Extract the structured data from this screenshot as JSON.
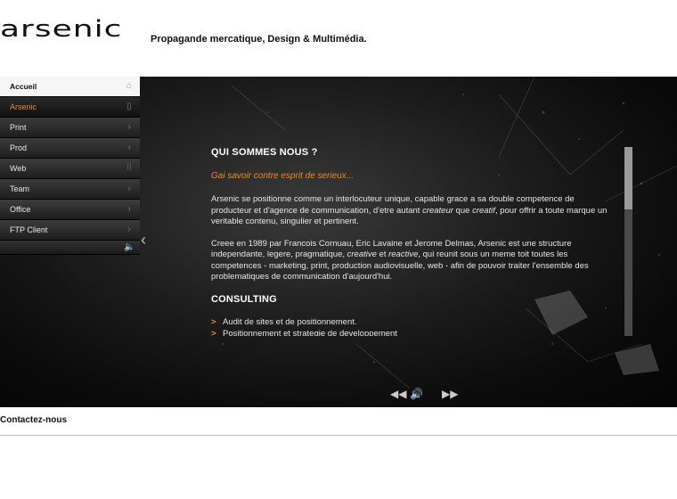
{
  "header": {
    "logo": "arsenic",
    "tagline": "Propagande mercatique, Design & Multimédia."
  },
  "nav": {
    "items": [
      {
        "label": "Accueil",
        "icon": "home-icon"
      },
      {
        "label": "Arsenic",
        "icon": "document-icon"
      },
      {
        "label": "Print",
        "icon": "chevron-right-icon"
      },
      {
        "label": "Prod",
        "icon": "chevron-right-icon"
      },
      {
        "label": "Web",
        "icon": "grid-icon"
      },
      {
        "label": "Team",
        "icon": "chevron-right-icon"
      },
      {
        "label": "Office",
        "icon": "chevron-right-icon"
      },
      {
        "label": "FTP Client",
        "icon": "chevron-right-icon"
      }
    ],
    "active": "Arsenic",
    "accent_color": "#f08a1c"
  },
  "content": {
    "title": "QUI SOMMES NOUS ?",
    "subtitle": "Gai savoir contre esprit de serieux...",
    "p1_a": "Arsenic se positionne comme un interlocuteur unique, capable grace a sa double competence de producteur et d'agence de communication, d'etre autant ",
    "p1_em1": "createur",
    "p1_b": " que ",
    "p1_em2": "creatif",
    "p1_c": ", pour offrir a toute marque un veritable contenu, singulier et pertinent.",
    "p2_a": " Creee en 1989 par Francois Cornuau, Eric Lavaine et Jerome Delmas, Arsenic est une structure independante, legere, pragmatique, ",
    "p2_em1": "creative",
    "p2_b": " et ",
    "p2_em2": "reactive",
    "p2_c": ", qui reunit sous un meme toit toutes les competences - marketing, print, production audiovisuelle, web - afin de pouvoir traiter l'ensemble des problematiques de communication d'aujourd'hui.",
    "consulting_title": "CONSULTING",
    "bullets": [
      "Audit de sites et de positionnement.",
      "Positionnement et strategie de developpement"
    ]
  },
  "footer": {
    "contact": "Contactez-nous"
  }
}
